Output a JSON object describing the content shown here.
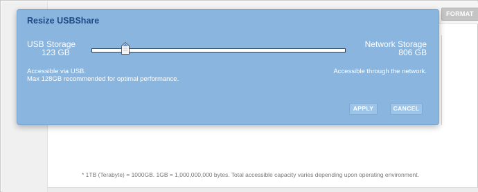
{
  "background": {
    "format_button_label": "FORMAT",
    "footnote": "* 1TB (Terabyte) = 1000GB. 1GB = 1,000,000,000 bytes. Total accessible capacity varies depending upon operating environment."
  },
  "dialog": {
    "title": "Resize USBShare",
    "usb": {
      "label": "USB Storage",
      "value": "123 GB",
      "desc_line1": "Accessible via USB.",
      "desc_line2": "Max 128GB recommended for optimal performance."
    },
    "network": {
      "label": "Network Storage",
      "value": "806 GB",
      "desc": "Accessible through the network."
    },
    "slider": {
      "min": 0,
      "max": 929,
      "value": 123
    },
    "buttons": {
      "apply": "APPLY",
      "cancel": "CANCEL"
    },
    "colors": {
      "dialog_bg": "#8ab5de",
      "title": "#1d4a86",
      "button_bg": "#9cc3e8"
    }
  }
}
